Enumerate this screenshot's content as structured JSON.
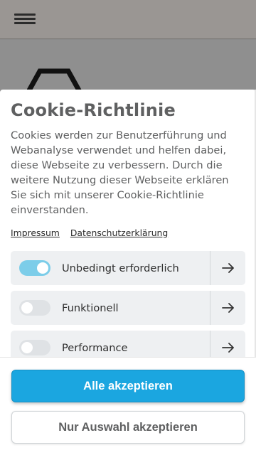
{
  "background": {
    "menu_icon": "hamburger-icon",
    "logo_icon": "hexagon-logo-icon"
  },
  "cookie": {
    "title": "Cookie-Richtlinie",
    "description": "Cookies werden zur Benutzerführung und Webanalyse verwendet und helfen dabei, diese Webseite zu verbessern. Durch die weitere Nutzung dieser Webseite erklären Sie sich mit unserer Cookie-Richtlinie einverstanden.",
    "links": {
      "impressum": "Impressum",
      "privacy": "Datenschutzerklärung"
    },
    "categories": [
      {
        "label": "Unbedingt erforderlich",
        "enabled": true,
        "icon": "arrow-right-icon"
      },
      {
        "label": "Funktionell",
        "enabled": false,
        "icon": "arrow-right-icon"
      },
      {
        "label": "Performance",
        "enabled": false,
        "icon": "arrow-right-icon"
      }
    ],
    "buttons": {
      "accept_all": "Alle akzeptieren",
      "accept_selection": "Nur Auswahl akzeptieren"
    },
    "colors": {
      "primary": "#1ba6e0",
      "toggle_on": "#7ccde9",
      "toggle_off": "#dfe2e5",
      "text": "#5f6061"
    }
  }
}
